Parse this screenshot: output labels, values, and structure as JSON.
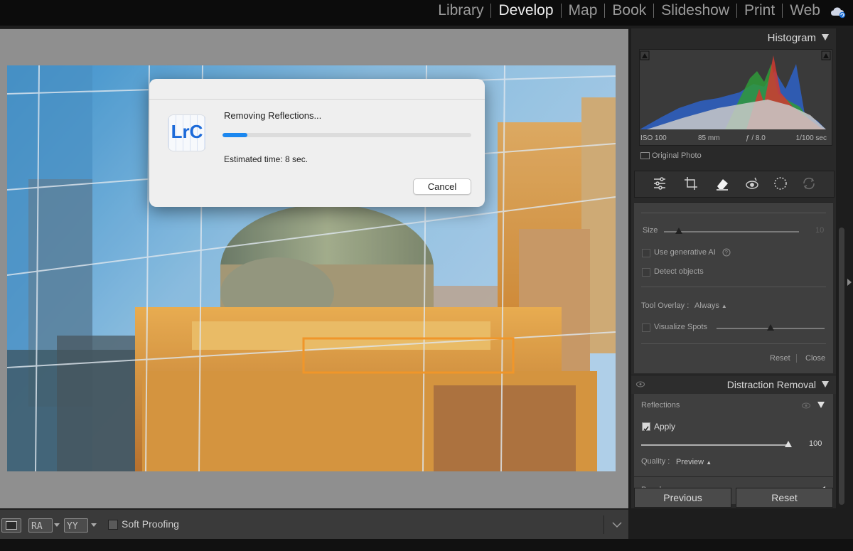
{
  "modules": {
    "items": [
      "Library",
      "Develop",
      "Map",
      "Book",
      "Slideshow",
      "Print",
      "Web"
    ],
    "active": "Develop"
  },
  "dialog": {
    "app_icon": "LrC",
    "title": "Removing Reflections...",
    "progress": 0.1,
    "estimate": "Estimated time: 8 sec.",
    "cancel_label": "Cancel"
  },
  "toolbar": {
    "soft_proofing_label": "Soft Proofing",
    "view_icons": [
      "loupe-view-icon",
      "before-after-left-right-icon",
      "before-after-top-bottom-icon"
    ]
  },
  "histogram": {
    "title": "Histogram",
    "iso": "ISO 100",
    "focal": "85 mm",
    "aperture": "ƒ / 8.0",
    "shutter": "1/100 sec",
    "original_photo_label": "Original Photo"
  },
  "tools": [
    "sliders-icon",
    "crop-icon",
    "eraser-icon",
    "red-eye-icon",
    "mask-icon",
    "presets-icon"
  ],
  "remove_tool": {
    "size_label": "Size",
    "size_value": "10",
    "use_gen_ai_label": "Use generative AI",
    "detect_objects_label": "Detect objects",
    "tool_overlay_label": "Tool Overlay :",
    "tool_overlay_value": "Always",
    "visualize_spots_label": "Visualize Spots",
    "reset_label": "Reset",
    "close_label": "Close"
  },
  "distraction_removal": {
    "title": "Distraction Removal",
    "reflections_label": "Reflections",
    "apply_label": "Apply",
    "amount_value": "100",
    "quality_label": "Quality :",
    "quality_value": "Preview",
    "people_label": "People"
  },
  "buttons": {
    "previous": "Previous",
    "reset": "Reset"
  },
  "colors": {
    "accent": "#1b87ef",
    "selection": "#f0962a"
  }
}
